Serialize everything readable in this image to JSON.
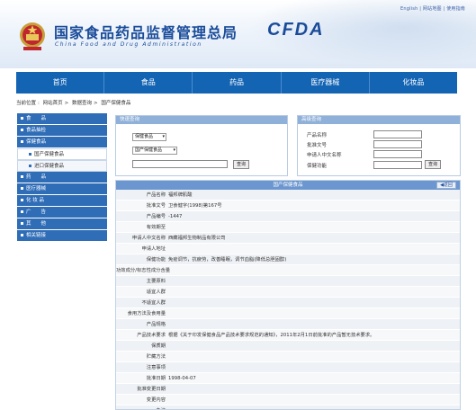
{
  "toplinks": "English | 网站地图 | 使用指南",
  "header": {
    "title_cn": "国家食品药品监督管理总局",
    "title_en": "China Food and Drug Administration",
    "logo_abbr": "CFDA"
  },
  "nav": [
    "首页",
    "食品",
    "药品",
    "医疗器械",
    "化妆品"
  ],
  "breadcrumb": [
    "当前位置",
    "网站首页",
    "数据查询",
    "国产保健食品"
  ],
  "sidebar": [
    {
      "label": "食　　品",
      "type": "main"
    },
    {
      "label": "食品抽检",
      "type": "main"
    },
    {
      "label": "保健食品",
      "type": "main"
    },
    {
      "label": "国产保健食品",
      "type": "sub",
      "active": true
    },
    {
      "label": "进口保健食品",
      "type": "sub"
    },
    {
      "label": "药　　品",
      "type": "main"
    },
    {
      "label": "医疗器械",
      "type": "main"
    },
    {
      "label": "化 妆 品",
      "type": "main"
    },
    {
      "label": "广　　告",
      "type": "main"
    },
    {
      "label": "其　　他",
      "type": "main"
    },
    {
      "label": "相关链接",
      "type": "main"
    }
  ],
  "quick_search": {
    "title": "快速查询",
    "select1": "保健食品",
    "select2": "国产保健食品",
    "button": "查询"
  },
  "advanced_search": {
    "title": "高级查询",
    "fields": [
      "产品名称",
      "批准文号",
      "申请人中文名称",
      "保健功能"
    ],
    "button": "查询"
  },
  "detail": {
    "title": "国产保健食品",
    "back": "返回",
    "rows": [
      {
        "k": "产品名称",
        "v": "福邦牌肌酸"
      },
      {
        "k": "批准文号",
        "v": "卫食健字(1998)第167号"
      },
      {
        "k": "产品编号",
        "v": "-1447"
      },
      {
        "k": "有效期至",
        "v": ""
      },
      {
        "k": "申请人中文名称",
        "v": "西藏福邦生物制品有限公司"
      },
      {
        "k": "申请人地址",
        "v": ""
      },
      {
        "k": "保健功能",
        "v": "免疫调节，抗疲劳，改善睡眠，调节血脂(降低总胆固醇)"
      },
      {
        "k": "功效成分/标志性成分含量",
        "v": ""
      },
      {
        "k": "主要原料",
        "v": ""
      },
      {
        "k": "适宜人群",
        "v": ""
      },
      {
        "k": "不适宜人群",
        "v": ""
      },
      {
        "k": "食用方法及食用量",
        "v": ""
      },
      {
        "k": "产品规格",
        "v": ""
      },
      {
        "k": "产品技术要求",
        "v": "根据《关于印发保健食品产品技术要求规范的通知》，2011年2月1日前批准的产品暂无技术要求。"
      },
      {
        "k": "保质期",
        "v": ""
      },
      {
        "k": "贮藏方法",
        "v": ""
      },
      {
        "k": "注意事项",
        "v": ""
      },
      {
        "k": "批准日期",
        "v": "1998-04-07"
      },
      {
        "k": "批准变更日期",
        "v": ""
      },
      {
        "k": "变更内容",
        "v": ""
      },
      {
        "k": "备注",
        "v": ""
      }
    ]
  }
}
